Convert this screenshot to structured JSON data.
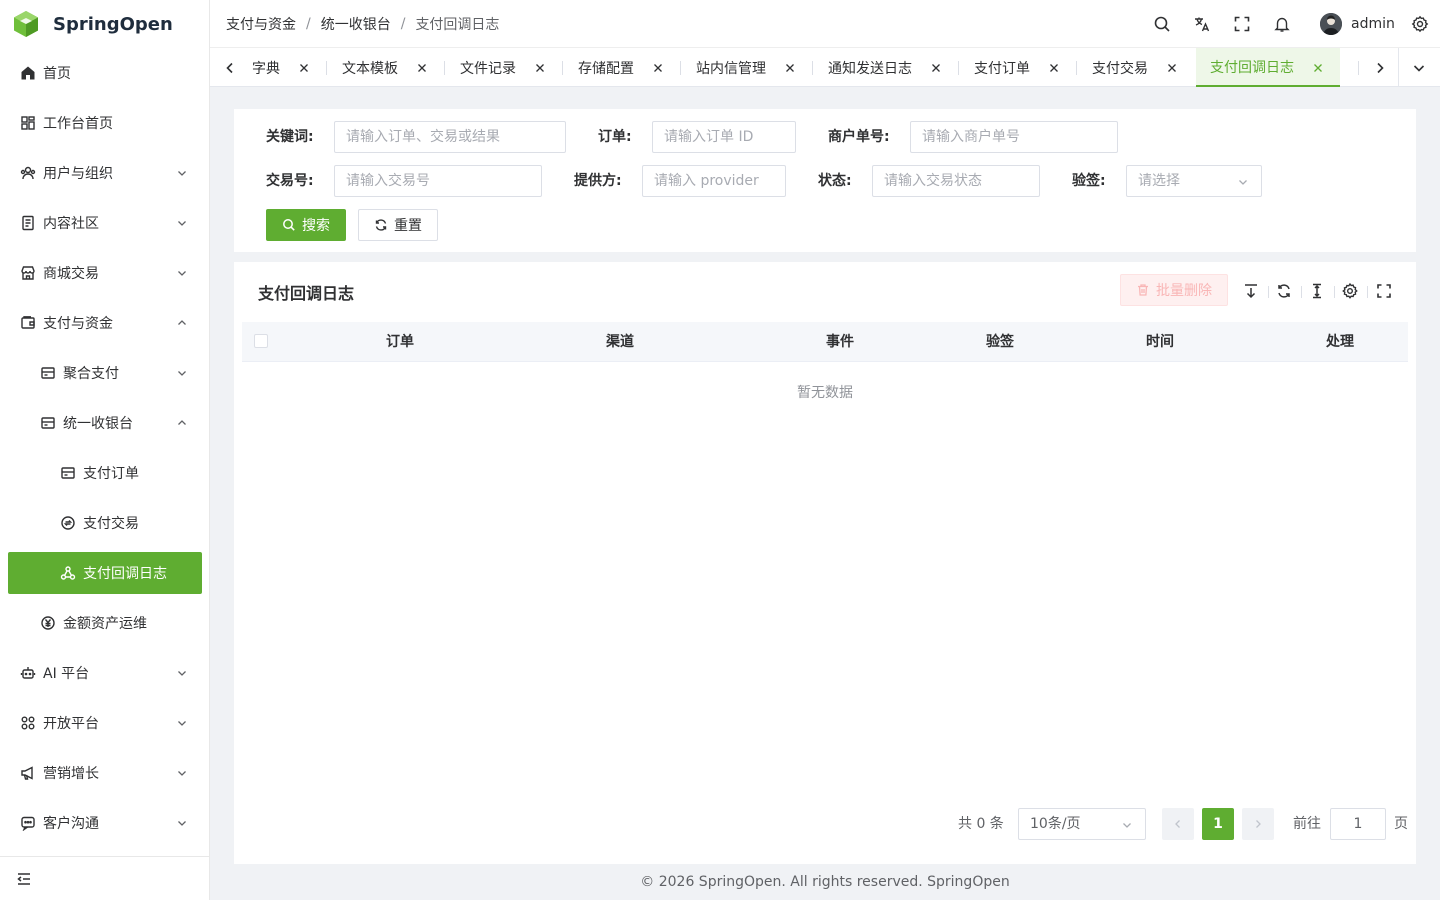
{
  "app": {
    "brand": "SpringOpen",
    "accent": "#5fad31"
  },
  "sidebar": {
    "items": [
      {
        "label": "首页",
        "icon": "home-icon"
      },
      {
        "label": "工作台首页",
        "icon": "dashboard-icon"
      },
      {
        "label": "用户与组织",
        "icon": "users-icon"
      },
      {
        "label": "内容社区",
        "icon": "document-icon"
      },
      {
        "label": "商城交易",
        "icon": "shop-icon"
      },
      {
        "label": "支付与资金",
        "icon": "wallet-icon"
      },
      {
        "label": "聚合支付",
        "icon": "card-icon"
      },
      {
        "label": "统一收银台",
        "icon": "card-icon"
      },
      {
        "label": "支付订单",
        "icon": "card-icon"
      },
      {
        "label": "支付交易",
        "icon": "exchange-icon"
      },
      {
        "label": "支付回调日志",
        "icon": "webhook-icon"
      },
      {
        "label": "金额资产运维",
        "icon": "currency-icon"
      },
      {
        "label": "AI 平台",
        "icon": "robot-icon"
      },
      {
        "label": "开放平台",
        "icon": "apps-icon"
      },
      {
        "label": "营销增长",
        "icon": "megaphone-icon"
      },
      {
        "label": "客户沟通",
        "icon": "chat-icon"
      }
    ]
  },
  "header": {
    "breadcrumb": [
      "支付与资金",
      "统一收银台",
      "支付回调日志"
    ],
    "user": "admin"
  },
  "tabs": [
    "字典",
    "文本模板",
    "文件记录",
    "存储配置",
    "站内信管理",
    "通知发送日志",
    "支付订单",
    "支付交易",
    "支付回调日志"
  ],
  "search": {
    "keyword_label": "关键词:",
    "keyword_placeholder": "请输入订单、交易或结果",
    "order_label": "订单:",
    "order_placeholder": "请输入订单 ID",
    "merchant_label": "商户单号:",
    "merchant_placeholder": "请输入商户单号",
    "trade_label": "交易号:",
    "trade_placeholder": "请输入交易号",
    "provider_label": "提供方:",
    "provider_placeholder": "请输入 provider",
    "status_label": "状态:",
    "status_placeholder": "请输入交易状态",
    "verify_label": "验签:",
    "verify_placeholder": "请选择",
    "search_btn": "搜索",
    "reset_btn": "重置"
  },
  "table": {
    "title": "支付回调日志",
    "batch_delete": "批量删除",
    "columns": [
      "订单",
      "渠道",
      "事件",
      "验签",
      "时间",
      "处理"
    ],
    "empty_text": "暂无数据"
  },
  "pager": {
    "total": "共 0 条",
    "page_size": "10条/页",
    "current": "1",
    "goto_label": "前往",
    "goto_value": "1",
    "page_suffix": "页"
  },
  "footer": "© 2026 SpringOpen. All rights reserved. SpringOpen"
}
